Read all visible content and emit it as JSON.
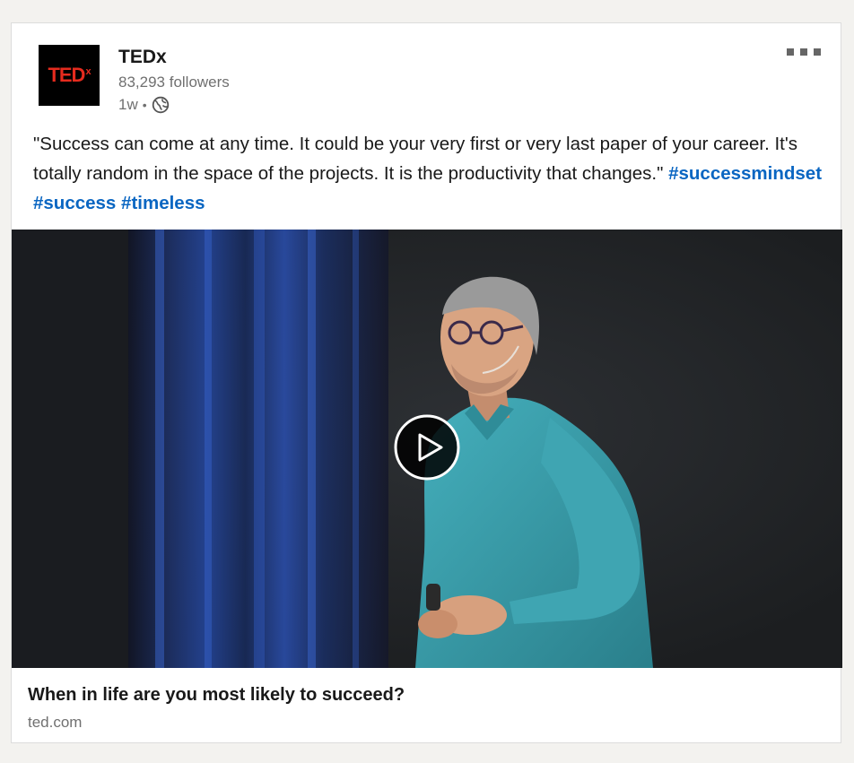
{
  "post": {
    "author": {
      "name": "TEDx",
      "followers": "83,293 followers",
      "time": "1w",
      "separator": "•",
      "logo_text": "TED",
      "logo_sup": "x",
      "visibility_icon": "globe-icon"
    },
    "more_icon": "ellipsis-icon",
    "text_main": "\"Success can come at any time. It could be your very first or very last paper of your career. It's totally random in the space of the projects. It is the productivity that changes.\"",
    "hashtags": [
      "#successmindset",
      "#success",
      "#timeless"
    ],
    "media": {
      "type": "video",
      "play_icon": "play-icon"
    },
    "link": {
      "title": "When in life are you most likely to succeed?",
      "domain": "ted.com"
    }
  },
  "colors": {
    "brand_red": "#e62b1e",
    "hashtag_blue": "#0a66c2",
    "shirt_teal": "#3a9ba8",
    "curtain_blue": "#1f3f8a"
  }
}
